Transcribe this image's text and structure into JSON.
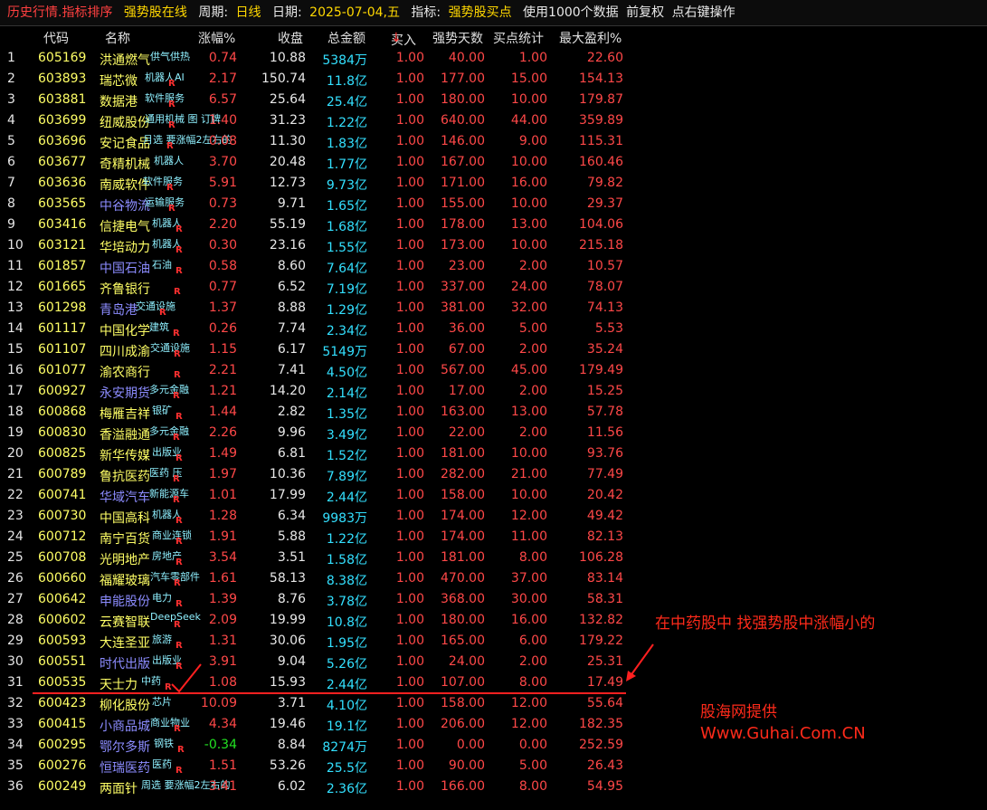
{
  "topbar": {
    "title": "历史行情.指标排序",
    "screen_name": "强势股在线",
    "period_label": "周期:",
    "period_value": "日线",
    "date_label": "日期:",
    "date_value": "2025-07-04,五",
    "indicator_label": "指标:",
    "indicator_value": "强势股买点",
    "data_note": "使用1000个数据",
    "adjust": "前复权",
    "hint": "点右键操作"
  },
  "columns": {
    "code": "代码",
    "name": "名称",
    "change": "涨幅%",
    "close": "收盘",
    "amount": "总金额",
    "buy": "买入",
    "sort_arrow": "↓",
    "days": "强势天数",
    "stats": "买点统计",
    "max_profit": "最大盈利%"
  },
  "rows": [
    {
      "idx": "1",
      "code": "605169",
      "name": "洪通燃气",
      "tag": "供气供热",
      "r": "",
      "change": "0.74",
      "close": "10.88",
      "amount": "5384万",
      "buy": "1.00",
      "days": "40.00",
      "stats": "1.00",
      "max_profit": "22.60",
      "name_color": "yellow",
      "change_color": "red"
    },
    {
      "idx": "2",
      "code": "603893",
      "name": "瑞芯微",
      "tag": "机器人AI",
      "r": "R",
      "change": "2.17",
      "close": "150.74",
      "amount": "11.8亿",
      "buy": "1.00",
      "days": "177.00",
      "stats": "15.00",
      "max_profit": "154.13",
      "name_color": "yellow",
      "change_color": "red"
    },
    {
      "idx": "3",
      "code": "603881",
      "name": "数据港",
      "tag": "软件服务",
      "r": "R",
      "change": "6.57",
      "close": "25.64",
      "amount": "25.4亿",
      "buy": "1.00",
      "days": "180.00",
      "stats": "10.00",
      "max_profit": "179.87",
      "name_color": "yellow",
      "change_color": "red"
    },
    {
      "idx": "4",
      "code": "603699",
      "name": "纽威股份",
      "tag": "通用机械 图 订牌",
      "r": "R",
      "change": "1.40",
      "close": "31.23",
      "amount": "1.22亿",
      "buy": "1.00",
      "days": "640.00",
      "stats": "44.00",
      "max_profit": "359.89",
      "name_color": "yellow",
      "change_color": "red"
    },
    {
      "idx": "5",
      "code": "603696",
      "name": "安记食品",
      "tag": "月选 要涨幅2左右的",
      "r": "R",
      "change": "0.08",
      "close": "11.30",
      "amount": "1.83亿",
      "buy": "1.00",
      "days": "146.00",
      "stats": "9.00",
      "max_profit": "115.31",
      "name_color": "yellow",
      "change_color": "red"
    },
    {
      "idx": "6",
      "code": "603677",
      "name": "奇精机械",
      "tag": "机器人",
      "r": "",
      "change": "3.70",
      "close": "20.48",
      "amount": "1.77亿",
      "buy": "1.00",
      "days": "167.00",
      "stats": "10.00",
      "max_profit": "160.46",
      "name_color": "yellow",
      "change_color": "red"
    },
    {
      "idx": "7",
      "code": "603636",
      "name": "南威软件",
      "tag": "软件服务",
      "r": "R",
      "change": "5.91",
      "close": "12.73",
      "amount": "9.73亿",
      "buy": "1.00",
      "days": "171.00",
      "stats": "16.00",
      "max_profit": "79.82",
      "name_color": "yellow",
      "change_color": "red"
    },
    {
      "idx": "8",
      "code": "603565",
      "name": "中谷物流",
      "tag": "运输服务",
      "r": "R",
      "change": "0.73",
      "close": "9.71",
      "amount": "1.65亿",
      "buy": "1.00",
      "days": "155.00",
      "stats": "10.00",
      "max_profit": "29.37",
      "name_color": "blue",
      "change_color": "red"
    },
    {
      "idx": "9",
      "code": "603416",
      "name": "信捷电气",
      "tag": "机器人",
      "r": "R",
      "change": "2.20",
      "close": "55.19",
      "amount": "1.68亿",
      "buy": "1.00",
      "days": "178.00",
      "stats": "13.00",
      "max_profit": "104.06",
      "name_color": "yellow",
      "change_color": "red"
    },
    {
      "idx": "10",
      "code": "603121",
      "name": "华培动力",
      "tag": "机器人",
      "r": "R",
      "change": "0.30",
      "close": "23.16",
      "amount": "1.55亿",
      "buy": "1.00",
      "days": "173.00",
      "stats": "10.00",
      "max_profit": "215.18",
      "name_color": "yellow",
      "change_color": "red"
    },
    {
      "idx": "11",
      "code": "601857",
      "name": "中国石油",
      "tag": "石油",
      "r": "R",
      "change": "0.58",
      "close": "8.60",
      "amount": "7.64亿",
      "buy": "1.00",
      "days": "23.00",
      "stats": "2.00",
      "max_profit": "10.57",
      "name_color": "blue",
      "change_color": "red"
    },
    {
      "idx": "12",
      "code": "601665",
      "name": "齐鲁银行",
      "tag": "",
      "r": "R",
      "change": "0.77",
      "close": "6.52",
      "amount": "7.19亿",
      "buy": "1.00",
      "days": "337.00",
      "stats": "24.00",
      "max_profit": "78.07",
      "name_color": "yellow",
      "change_color": "red"
    },
    {
      "idx": "13",
      "code": "601298",
      "name": "青岛港",
      "tag": "交通设施",
      "r": "R",
      "change": "1.37",
      "close": "8.88",
      "amount": "1.29亿",
      "buy": "1.00",
      "days": "381.00",
      "stats": "32.00",
      "max_profit": "74.13",
      "name_color": "blue",
      "change_color": "red"
    },
    {
      "idx": "14",
      "code": "601117",
      "name": "中国化学",
      "tag": "建筑",
      "r": "R",
      "change": "0.26",
      "close": "7.74",
      "amount": "2.34亿",
      "buy": "1.00",
      "days": "36.00",
      "stats": "5.00",
      "max_profit": "5.53",
      "name_color": "yellow",
      "change_color": "red"
    },
    {
      "idx": "15",
      "code": "601107",
      "name": "四川成渝",
      "tag": "交通设施",
      "r": "R",
      "change": "1.15",
      "close": "6.17",
      "amount": "5149万",
      "buy": "1.00",
      "days": "67.00",
      "stats": "2.00",
      "max_profit": "35.24",
      "name_color": "yellow",
      "change_color": "red"
    },
    {
      "idx": "16",
      "code": "601077",
      "name": "渝农商行",
      "tag": "",
      "r": "R",
      "change": "2.21",
      "close": "7.41",
      "amount": "4.50亿",
      "buy": "1.00",
      "days": "567.00",
      "stats": "45.00",
      "max_profit": "179.49",
      "name_color": "yellow",
      "change_color": "red"
    },
    {
      "idx": "17",
      "code": "600927",
      "name": "永安期货",
      "tag": "多元金融",
      "r": "R",
      "change": "1.21",
      "close": "14.20",
      "amount": "2.14亿",
      "buy": "1.00",
      "days": "17.00",
      "stats": "2.00",
      "max_profit": "15.25",
      "name_color": "blue",
      "change_color": "red"
    },
    {
      "idx": "18",
      "code": "600868",
      "name": "梅雁吉祥",
      "tag": "银矿",
      "r": "R",
      "change": "1.44",
      "close": "2.82",
      "amount": "1.35亿",
      "buy": "1.00",
      "days": "163.00",
      "stats": "13.00",
      "max_profit": "57.78",
      "name_color": "yellow",
      "change_color": "red"
    },
    {
      "idx": "19",
      "code": "600830",
      "name": "香溢融通",
      "tag": "多元金融",
      "r": "R",
      "change": "2.26",
      "close": "9.96",
      "amount": "3.49亿",
      "buy": "1.00",
      "days": "22.00",
      "stats": "2.00",
      "max_profit": "11.56",
      "name_color": "yellow",
      "change_color": "red"
    },
    {
      "idx": "20",
      "code": "600825",
      "name": "新华传媒",
      "tag": "出版业",
      "r": "R",
      "change": "1.49",
      "close": "6.81",
      "amount": "1.52亿",
      "buy": "1.00",
      "days": "181.00",
      "stats": "10.00",
      "max_profit": "93.76",
      "name_color": "yellow",
      "change_color": "red"
    },
    {
      "idx": "21",
      "code": "600789",
      "name": "鲁抗医药",
      "tag": "医药 压",
      "r": "R",
      "change": "1.97",
      "close": "10.36",
      "amount": "7.89亿",
      "buy": "1.00",
      "days": "282.00",
      "stats": "21.00",
      "max_profit": "77.49",
      "name_color": "yellow",
      "change_color": "red"
    },
    {
      "idx": "22",
      "code": "600741",
      "name": "华域汽车",
      "tag": "新能源车",
      "r": "R",
      "change": "1.01",
      "close": "17.99",
      "amount": "2.44亿",
      "buy": "1.00",
      "days": "158.00",
      "stats": "10.00",
      "max_profit": "20.42",
      "name_color": "blue",
      "change_color": "red"
    },
    {
      "idx": "23",
      "code": "600730",
      "name": "中国高科",
      "tag": "机器人",
      "r": "R",
      "change": "1.28",
      "close": "6.34",
      "amount": "9983万",
      "buy": "1.00",
      "days": "174.00",
      "stats": "12.00",
      "max_profit": "49.42",
      "name_color": "yellow",
      "change_color": "red"
    },
    {
      "idx": "24",
      "code": "600712",
      "name": "南宁百货",
      "tag": "商业连锁",
      "r": "R",
      "change": "1.91",
      "close": "5.88",
      "amount": "1.22亿",
      "buy": "1.00",
      "days": "174.00",
      "stats": "11.00",
      "max_profit": "82.13",
      "name_color": "yellow",
      "change_color": "red"
    },
    {
      "idx": "25",
      "code": "600708",
      "name": "光明地产",
      "tag": "房地产",
      "r": "R",
      "change": "3.54",
      "close": "3.51",
      "amount": "1.58亿",
      "buy": "1.00",
      "days": "181.00",
      "stats": "8.00",
      "max_profit": "106.28",
      "name_color": "yellow",
      "change_color": "red"
    },
    {
      "idx": "26",
      "code": "600660",
      "name": "福耀玻璃",
      "tag": "汽车零部件",
      "r": "R",
      "change": "1.61",
      "close": "58.13",
      "amount": "8.38亿",
      "buy": "1.00",
      "days": "470.00",
      "stats": "37.00",
      "max_profit": "83.14",
      "name_color": "yellow",
      "change_color": "red"
    },
    {
      "idx": "27",
      "code": "600642",
      "name": "申能股份",
      "tag": "电力",
      "r": "R",
      "change": "1.39",
      "close": "8.76",
      "amount": "3.78亿",
      "buy": "1.00",
      "days": "368.00",
      "stats": "30.00",
      "max_profit": "58.31",
      "name_color": "blue",
      "change_color": "red"
    },
    {
      "idx": "28",
      "code": "600602",
      "name": "云赛智联",
      "tag": "DeepSeek",
      "r": "R",
      "change": "2.09",
      "close": "19.99",
      "amount": "10.8亿",
      "buy": "1.00",
      "days": "180.00",
      "stats": "16.00",
      "max_profit": "132.82",
      "name_color": "yellow",
      "change_color": "red"
    },
    {
      "idx": "29",
      "code": "600593",
      "name": "大连圣亚",
      "tag": "旅游",
      "r": "R",
      "change": "1.31",
      "close": "30.06",
      "amount": "1.95亿",
      "buy": "1.00",
      "days": "165.00",
      "stats": "6.00",
      "max_profit": "179.22",
      "name_color": "yellow",
      "change_color": "red"
    },
    {
      "idx": "30",
      "code": "600551",
      "name": "时代出版",
      "tag": "出版业",
      "r": "R",
      "change": "3.91",
      "close": "9.04",
      "amount": "5.26亿",
      "buy": "1.00",
      "days": "24.00",
      "stats": "2.00",
      "max_profit": "25.31",
      "name_color": "blue",
      "change_color": "red"
    },
    {
      "idx": "31",
      "code": "600535",
      "name": "天士力",
      "tag": "中药",
      "r": "R",
      "change": "1.08",
      "close": "15.93",
      "amount": "2.44亿",
      "buy": "1.00",
      "days": "107.00",
      "stats": "8.00",
      "max_profit": "17.49",
      "name_color": "yellow",
      "change_color": "red"
    },
    {
      "idx": "32",
      "code": "600423",
      "name": "柳化股份",
      "tag": "芯片",
      "r": "",
      "change": "10.09",
      "close": "3.71",
      "amount": "4.10亿",
      "buy": "1.00",
      "days": "158.00",
      "stats": "12.00",
      "max_profit": "55.64",
      "name_color": "yellow",
      "change_color": "red"
    },
    {
      "idx": "33",
      "code": "600415",
      "name": "小商品城",
      "tag": "商业物业",
      "r": "R",
      "change": "4.34",
      "close": "19.46",
      "amount": "19.1亿",
      "buy": "1.00",
      "days": "206.00",
      "stats": "12.00",
      "max_profit": "182.35",
      "name_color": "blue",
      "change_color": "red"
    },
    {
      "idx": "34",
      "code": "600295",
      "name": "鄂尔多斯",
      "tag": "钢铁",
      "r": "R",
      "change": "-0.34",
      "close": "8.84",
      "amount": "8274万",
      "buy": "1.00",
      "days": "0.00",
      "stats": "0.00",
      "max_profit": "252.59",
      "name_color": "blue",
      "change_color": "green"
    },
    {
      "idx": "35",
      "code": "600276",
      "name": "恒瑞医药",
      "tag": "医药",
      "r": "R",
      "change": "1.51",
      "close": "53.26",
      "amount": "25.5亿",
      "buy": "1.00",
      "days": "90.00",
      "stats": "5.00",
      "max_profit": "26.43",
      "name_color": "blue",
      "change_color": "red"
    },
    {
      "idx": "36",
      "code": "600249",
      "name": "两面针",
      "tag": "周选 要涨幅2左右的",
      "r": "",
      "change": "3.41",
      "close": "6.02",
      "amount": "2.36亿",
      "buy": "1.00",
      "days": "166.00",
      "stats": "8.00",
      "max_profit": "54.95",
      "name_color": "yellow",
      "change_color": "red"
    }
  ],
  "annotation": "在中药股中 找强势股中涨幅小的",
  "credit": {
    "line1": "股海网提供",
    "line2": "Www.Guhai.Com.CN"
  },
  "colors": {
    "background": "#000000",
    "code": "#ffff66",
    "up": "#ff4848",
    "down": "#22e022",
    "amount": "#33e0ff",
    "tag": "#8ff0ff",
    "annotation": "#ff2a1a"
  }
}
